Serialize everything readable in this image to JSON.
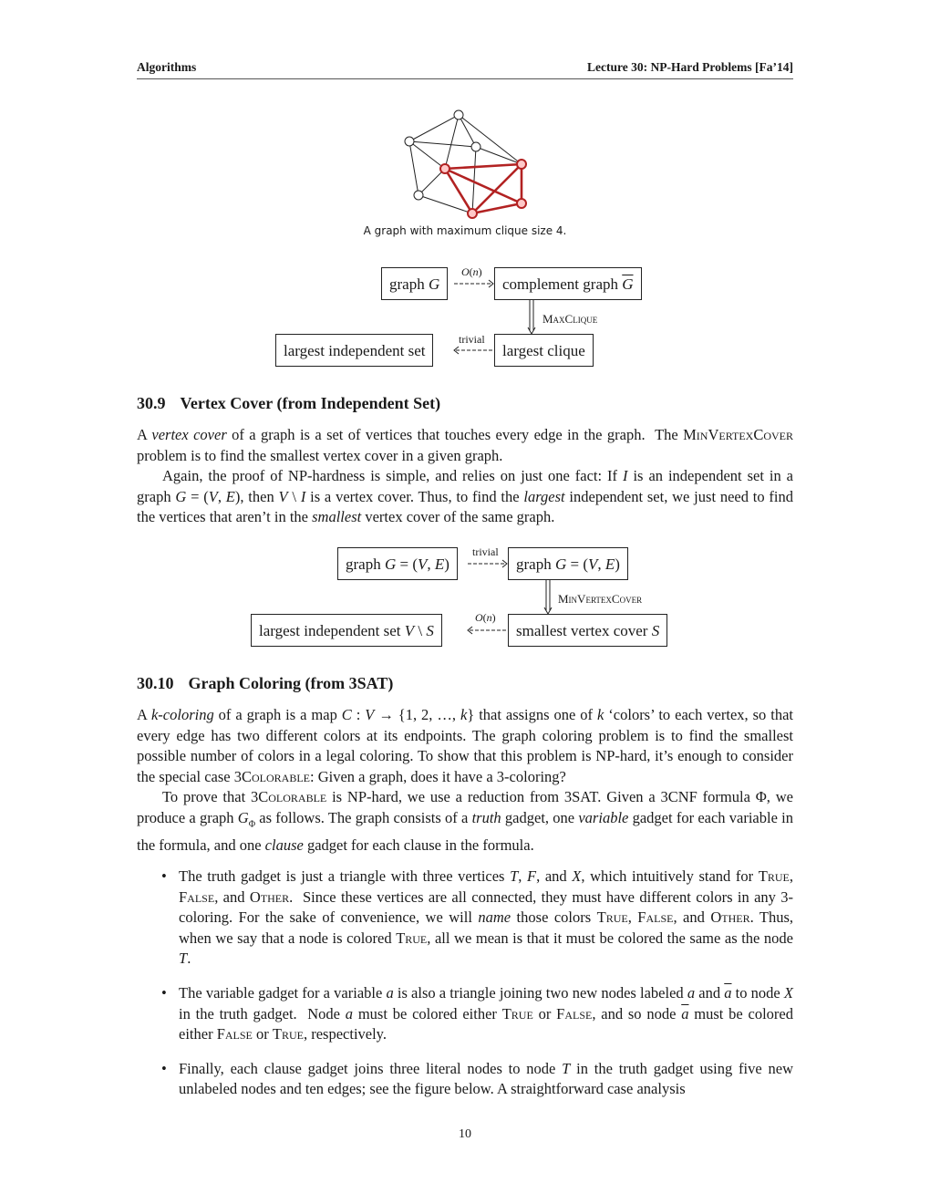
{
  "header": {
    "left": "Algorithms",
    "right": "Lecture 30: NP-Hard Problems [Fa’14]"
  },
  "figure1": {
    "caption": "A graph with maximum clique size 4.",
    "colors": {
      "clique": "#b22222",
      "clique_fill": "#ffc9c9",
      "normal": "#222222"
    }
  },
  "diagram1": {
    "box_graph": "graph G",
    "box_complement": "complement graph G",
    "box_clique": "largest clique",
    "box_indep": "largest independent set",
    "label_top": "O(n)",
    "label_right": "MaxClique",
    "label_bottom": "trivial"
  },
  "section_30_9": {
    "number": "30.9",
    "title": "Vertex Cover (from Independent Set)",
    "p1": "A vertex cover of a graph is a set of vertices that touches every edge in the graph. The MinVertexCover problem is to find the smallest vertex cover in a given graph.",
    "p2": "Again, the proof of NP-hardness is simple, and relies on just one fact: If I is an independent set in a graph G = (V, E), then V \\ I is a vertex cover. Thus, to find the largest independent set, we just need to find the vertices that aren’t in the smallest vertex cover of the same graph."
  },
  "diagram2": {
    "box_graph1": "graph G = (V, E)",
    "box_graph2": "graph G = (V, E)",
    "box_cover": "smallest vertex cover S",
    "box_indep": "largest independent set V \\ S",
    "label_top": "trivial",
    "label_right": "MinVertexCover",
    "label_bottom": "O(n)"
  },
  "section_30_10": {
    "number": "30.10",
    "title": "Graph Coloring (from 3SAT)",
    "p1": "A k-coloring of a graph is a map C : V → {1, 2, …, k} that assigns one of k ‘colors’ to each vertex, so that every edge has two different colors at its endpoints. The graph coloring problem is to find the smallest possible number of colors in a legal coloring. To show that this problem is NP-hard, it’s enough to consider the special case 3Colorable: Given a graph, does it have a 3-coloring?",
    "p2": "To prove that 3Colorable is NP-hard, we use a reduction from 3SAT. Given a 3CNF formula Φ, we produce a graph GΦ as follows. The graph consists of a truth gadget, one variable gadget for each variable in the formula, and one clause gadget for each clause in the formula.",
    "bullets": [
      "The truth gadget is just a triangle with three vertices T, F, and X, which intuitively stand for True, False, and Other. Since these vertices are all connected, they must have different colors in any 3-coloring. For the sake of convenience, we will name those colors True, False, and Other. Thus, when we say that a node is colored True, all we mean is that it must be colored the same as the node T.",
      "The variable gadget for a variable a is also a triangle joining two new nodes labeled a and ā to node X in the truth gadget. Node a must be colored either True or False, and so node ā must be colored either False or True, respectively.",
      "Finally, each clause gadget joins three literal nodes to node T in the truth gadget using five new unlabeled nodes and ten edges; see the figure below. A straightforward case analysis"
    ]
  },
  "page_number": "10"
}
